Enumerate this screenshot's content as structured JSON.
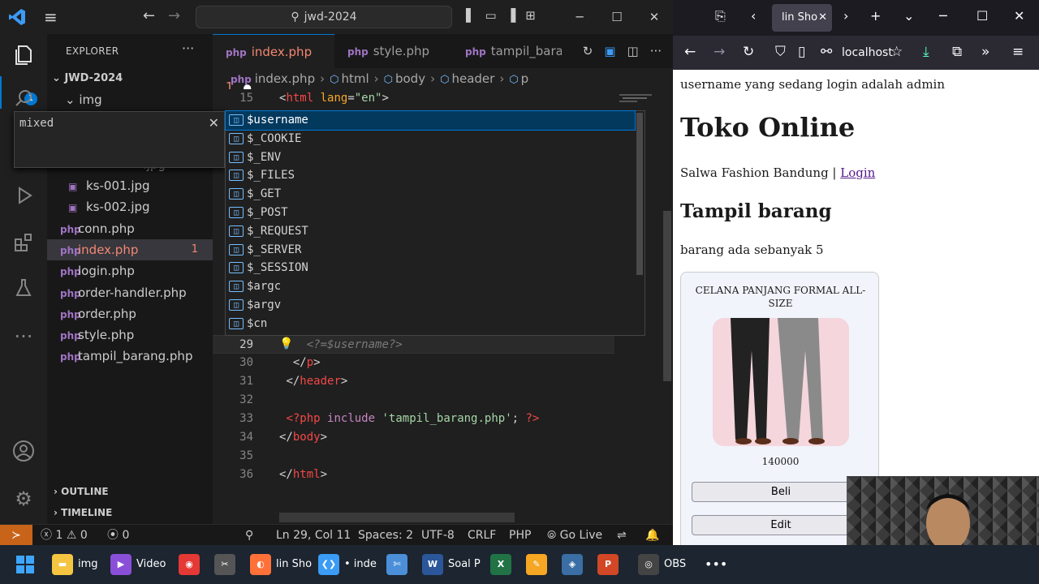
{
  "vscode": {
    "search_text": "jwd-2024",
    "explorer_label": "EXPLORER",
    "explorer_badge": "1",
    "workspace": "JWD-2024",
    "folder": "img",
    "files": [
      {
        "name": "ks-001.jpg",
        "type": "jpg",
        "badge": ""
      },
      {
        "name": "ks-002.jpg",
        "type": "jpg",
        "badge": ""
      },
      {
        "name": "conn.php",
        "type": "php",
        "badge": ""
      },
      {
        "name": "index.php",
        "type": "php",
        "badge": "1"
      },
      {
        "name": "login.php",
        "type": "php",
        "badge": ""
      },
      {
        "name": "order-handler.php",
        "type": "php",
        "badge": ""
      },
      {
        "name": "order.php",
        "type": "php",
        "badge": ""
      },
      {
        "name": "style.php",
        "type": "php",
        "badge": ""
      },
      {
        "name": "tampil_barang.php",
        "type": "php",
        "badge": ""
      }
    ],
    "partial_file": ".jpg",
    "outline_label": "OUTLINE",
    "timeline_label": "TIMELINE",
    "find_value": "mixed",
    "tabs": [
      {
        "label": "index.php 1"
      },
      {
        "label": "style.php"
      },
      {
        "label": "tampil_barang"
      }
    ],
    "breadcrumb": [
      "index.php",
      "html",
      "body",
      "header",
      "p"
    ],
    "code_lines": [
      {
        "n": "15",
        "parts": [
          [
            "t-punc",
            "<"
          ],
          [
            "t-tag",
            "html"
          ],
          [
            "t-plain",
            " "
          ],
          [
            "t-attr",
            "lang"
          ],
          [
            "t-punc",
            "="
          ],
          [
            "t-str",
            "\"en\""
          ],
          [
            "t-punc",
            ">"
          ]
        ]
      },
      {
        "n": "29",
        "parts": [
          [
            "t-plain",
            "    "
          ],
          [
            "t-ghost",
            "<?="
          ],
          [
            "t-ghost",
            "$username"
          ],
          [
            "t-ghost",
            "?>"
          ]
        ]
      },
      {
        "n": "30",
        "parts": [
          [
            "t-plain",
            "  "
          ],
          [
            "t-punc",
            "</"
          ],
          [
            "t-tag",
            "p"
          ],
          [
            "t-punc",
            ">"
          ]
        ]
      },
      {
        "n": "31",
        "parts": [
          [
            "t-plain",
            " "
          ],
          [
            "t-punc",
            "</"
          ],
          [
            "t-tag",
            "header"
          ],
          [
            "t-punc",
            ">"
          ]
        ]
      },
      {
        "n": "32",
        "parts": []
      },
      {
        "n": "33",
        "parts": [
          [
            "t-plain",
            " "
          ],
          [
            "t-php",
            "<?php"
          ],
          [
            "t-plain",
            " "
          ],
          [
            "t-kw",
            "include"
          ],
          [
            "t-plain",
            " "
          ],
          [
            "t-str",
            "'tampil_barang.php'"
          ],
          [
            "t-plain",
            "; "
          ],
          [
            "t-php",
            "?>"
          ]
        ]
      },
      {
        "n": "34",
        "parts": [
          [
            "t-punc",
            "</"
          ],
          [
            "t-tag",
            "body"
          ],
          [
            "t-punc",
            ">"
          ]
        ]
      },
      {
        "n": "35",
        "parts": []
      },
      {
        "n": "36",
        "parts": [
          [
            "t-punc",
            "</"
          ],
          [
            "t-tag",
            "html"
          ],
          [
            "t-punc",
            ">"
          ]
        ]
      }
    ],
    "suggestions": [
      "$username",
      "$_COOKIE",
      "$_ENV",
      "$_FILES",
      "$_GET",
      "$_POST",
      "$_REQUEST",
      "$_SERVER",
      "$_SESSION",
      "$argc",
      "$argv",
      "$cn"
    ],
    "status": {
      "errors": "1",
      "warnings": "0",
      "ports": "0",
      "position": "Ln 29, Col 11",
      "spaces": "Spaces: 2",
      "encoding": "UTF-8",
      "eol": "CRLF",
      "language": "PHP",
      "golive": "Go Live"
    }
  },
  "browser": {
    "tab_title": "lin Sho",
    "url": "localhost",
    "page": {
      "status": "username yang sedang login adalah admin",
      "title": "Toko Online",
      "shop_text": "Salwa Fashion Bandung | ",
      "login_link": "Login",
      "section_title": "Tampil barang",
      "count_text": "barang ada sebanyak 5",
      "product": {
        "name": "CELANA PANJANG FORMAL ALL-SIZE",
        "price": "140000",
        "buy_label": "Beli",
        "edit_label": "Edit"
      }
    }
  },
  "taskbar": {
    "items": [
      {
        "label": "img",
        "icon": "folder-icon",
        "color": "#f5c542"
      },
      {
        "label": "Video",
        "icon": "video-icon",
        "color": "#8a4fd8"
      },
      {
        "label": "",
        "icon": "chrome-icon",
        "color": "#e53935"
      },
      {
        "label": "",
        "icon": "clapper-icon",
        "color": "#555"
      },
      {
        "label": "lin Sho",
        "icon": "firefox-icon",
        "color": "#ff7139"
      },
      {
        "label": "• inde",
        "icon": "vscode-icon",
        "color": "#3b9bf5"
      },
      {
        "label": "",
        "icon": "snip-icon",
        "color": "#4a8fd8"
      },
      {
        "label": "Soal P",
        "icon": "word-icon",
        "color": "#2b579a"
      },
      {
        "label": "",
        "icon": "excel-icon",
        "color": "#217346"
      },
      {
        "label": "",
        "icon": "pen-icon",
        "color": "#f5a623"
      },
      {
        "label": "",
        "icon": "vbox-icon",
        "color": "#3a6ea5"
      },
      {
        "label": "",
        "icon": "powerpoint-icon",
        "color": "#d24726"
      },
      {
        "label": "OBS",
        "icon": "obs-icon",
        "color": "#444"
      }
    ],
    "more_label": "•••"
  }
}
